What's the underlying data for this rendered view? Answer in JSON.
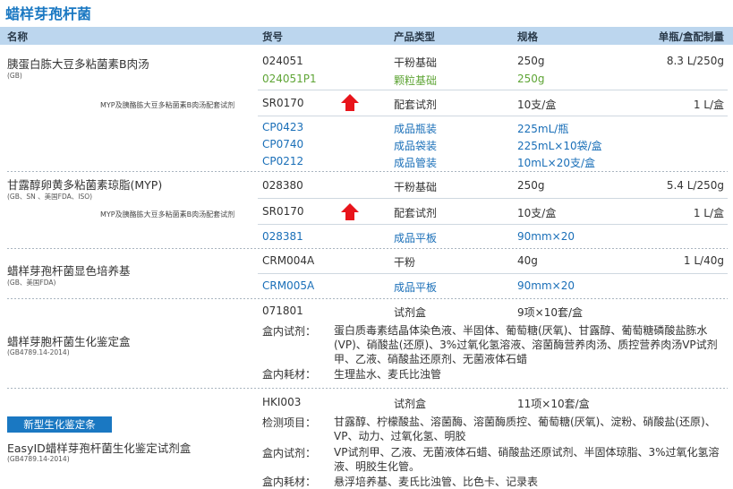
{
  "title": "蜡样芽孢杆菌",
  "header": {
    "name": "名称",
    "code": "货号",
    "type": "产品类型",
    "spec": "规格",
    "unit": "单瓶/盒配制量"
  },
  "g1": {
    "name": "胰蛋白胨大豆多粘菌素B肉汤",
    "std": "(GB)",
    "sub_label": "MYP及胰酪胨大豆多粘菌素B肉汤配套试剂",
    "rows": [
      {
        "code": "024051",
        "type": "干粉基础",
        "spec": "250g",
        "unit": "8.3 L/250g"
      },
      {
        "code": "024051P1",
        "type": "颗粒基础",
        "spec": "250g",
        "unit": ""
      },
      {
        "code": "SR0170",
        "type": "配套试剂",
        "spec": "10支/盒",
        "unit": "1 L/盒"
      },
      {
        "code": "CP0423",
        "type": "成品瓶装",
        "spec": "225mL/瓶",
        "unit": ""
      },
      {
        "code": "CP0740",
        "type": "成品袋装",
        "spec": "225mL×10袋/盒",
        "unit": ""
      },
      {
        "code": "CP0212",
        "type": "成品管装",
        "spec": "10mL×20支/盒",
        "unit": ""
      }
    ]
  },
  "g2": {
    "name": "甘露醇卵黄多粘菌素琼脂(MYP)",
    "std": "(GB、SN 、美国FDA、ISO)",
    "sub_label": "MYP及胰酪胨大豆多粘菌素B肉汤配套试剂",
    "rows": [
      {
        "code": "028380",
        "type": "干粉基础",
        "spec": "250g",
        "unit": "5.4 L/250g"
      },
      {
        "code": "SR0170",
        "type": "配套试剂",
        "spec": "10支/盒",
        "unit": "1 L/盒"
      },
      {
        "code": "028381",
        "type": "成品平板",
        "spec": "90mm×20",
        "unit": ""
      }
    ]
  },
  "g3": {
    "name": "蜡样芽孢杆菌显色培养基",
    "std": "(GB、美国FDA)",
    "rows": [
      {
        "code": "CRM004A",
        "type": "干粉",
        "spec": "40g",
        "unit": "1 L/40g"
      },
      {
        "code": "CRM005A",
        "type": "成品平板",
        "spec": "90mm×20",
        "unit": ""
      }
    ]
  },
  "g4": {
    "name": "蜡样芽胞杆菌生化鉴定盒",
    "std": "(GB4789.14-2014)",
    "code": "071801",
    "type": "试剂盒",
    "spec": "9项×10套/盒",
    "reagent_label": "盒内试剂：",
    "reagent_text": "蛋白质毒素结晶体染色液、半固体、葡萄糖(厌氧)、甘露醇、葡萄糖磷酸盐胨水(VP)、硝酸盐(还原)、3%过氧化氢溶液、溶菌酶营养肉汤、质控营养肉汤VP试剂甲、乙液、硝酸盐还原剂、无菌液体石蜡",
    "consumable_label": "盒内耗材：",
    "consumable_text": "生理盐水、麦氏比浊管"
  },
  "g5": {
    "badge": "新型生化鉴定条",
    "name": "EasyID蜡样芽孢杆菌生化鉴定试剂盒",
    "std": "(GB4789.14-2014)",
    "code": "HKI003",
    "type": "试剂盒",
    "spec": "11项×10套/盒",
    "items_label": "检测项目：",
    "items_text": "甘露醇、柠檬酸盐、溶菌酶、溶菌酶质控、葡萄糖(厌氧)、淀粉、硝酸盐(还原)、VP、动力、过氧化氢、明胶",
    "reagent_label": "盒内试剂：",
    "reagent_text": "VP试剂甲、乙液、无菌液体石蜡、硝酸盐还原试剂、半固体琼脂、3%过氧化氢溶液、明胶生化管。",
    "consumable_label": "盒内耗材：",
    "consumable_text": "悬浮培养基、麦氏比浊管、比色卡、记录表"
  },
  "colors": {
    "brand_blue": "#1a78c2",
    "header_bg": "#bcd6ee",
    "green": "#5fa536",
    "arrow_red": "#e8141b"
  }
}
